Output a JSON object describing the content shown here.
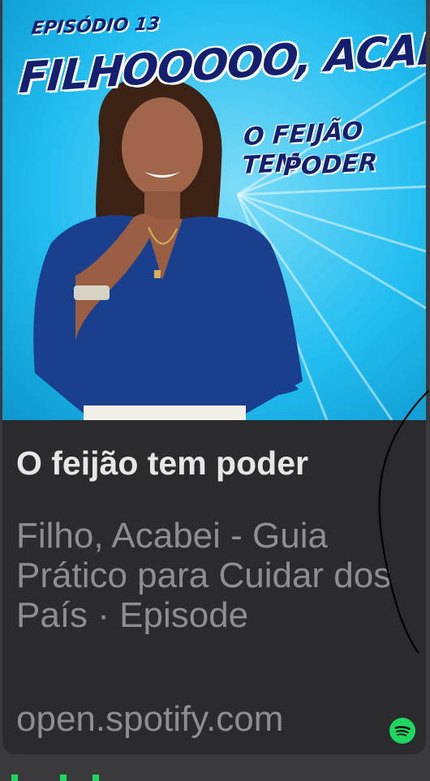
{
  "cover": {
    "episode_label": "EPISÓDIO 13",
    "headline": "FILHOOOOO, ACABEI!",
    "tagline_line1": "O FEIJÃO TEM",
    "tagline_line2": "PODER"
  },
  "link_preview": {
    "title": "O feijão tem poder",
    "subtitle": "Filho, Acabei - Guia Prático para Cuidar dos País · Episode",
    "domain": "open.spotify.com",
    "icon": "spotify-icon"
  },
  "colors": {
    "card_background": "#2b2b2d",
    "cover_background": "#19b7ea",
    "headline_color": "#14206d",
    "spotify_green": "#1ed760"
  }
}
